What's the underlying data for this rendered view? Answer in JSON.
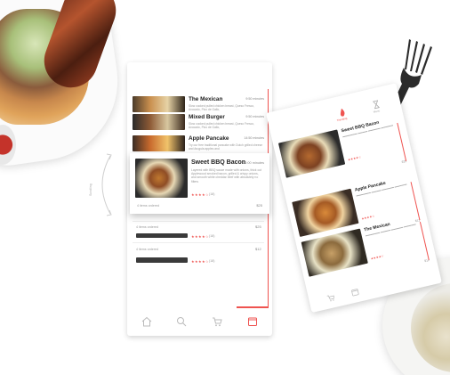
{
  "colors": {
    "accent": "#ef5350",
    "text": "#222222",
    "muted": "#999999"
  },
  "hint": {
    "scroll": "Scrolling"
  },
  "list": [
    {
      "title": "The Mexican",
      "meta": "9:50 minutes",
      "desc": "Slow cooked pulled chicken breast, Queso Fresco, Avocado, Pico de Gallo,",
      "thumb": "bowl"
    },
    {
      "title": "Mixed Burger",
      "meta": "9:50 minutes",
      "desc": "Slow cooked pulled chicken breast, Queso Fresco, Avocado, Pico de Gallo,",
      "thumb": "burger"
    },
    {
      "title": "Apple Pancake",
      "meta": "14:50 minutes",
      "desc": "Try our free traditional pancake with Dutch grilled cheese and Arugula apples and",
      "thumb": "pancake"
    }
  ],
  "featured": {
    "title": "Sweet BBQ Bacon",
    "meta": "20:00 minutes",
    "desc": "Layered with BBQ sauce made with onions, thick cut Applewood smoked bacon, grilled & crispy onions, and smooth white cheddar beef with absolutely no filters",
    "rating": "★★★★☆",
    "reviews": "(18)",
    "ordered": "4 items ordered",
    "price": "$25"
  },
  "rows": [
    {
      "ordered": "4 items ordered",
      "price": "$25",
      "rating": "★★★★☆",
      "reviews": "(18)"
    },
    {
      "ordered": "4 items ordered",
      "price": "$12",
      "rating": "★★★★☆",
      "reviews": "(18)"
    }
  ],
  "nav": [
    "home-icon",
    "search-icon",
    "cart-icon",
    "menu-icon"
  ],
  "phone2": {
    "top_labels": [
      "Trending",
      "Menu"
    ],
    "cards": [
      {
        "title": "Sweet BBQ Bacon",
        "price": "$25",
        "thumb": "burger"
      },
      {
        "title": "Apple Pancake",
        "price": "$12",
        "thumb": "pancake"
      },
      {
        "title": "The Mexican",
        "price": "$12",
        "thumb": "bowl"
      }
    ]
  }
}
